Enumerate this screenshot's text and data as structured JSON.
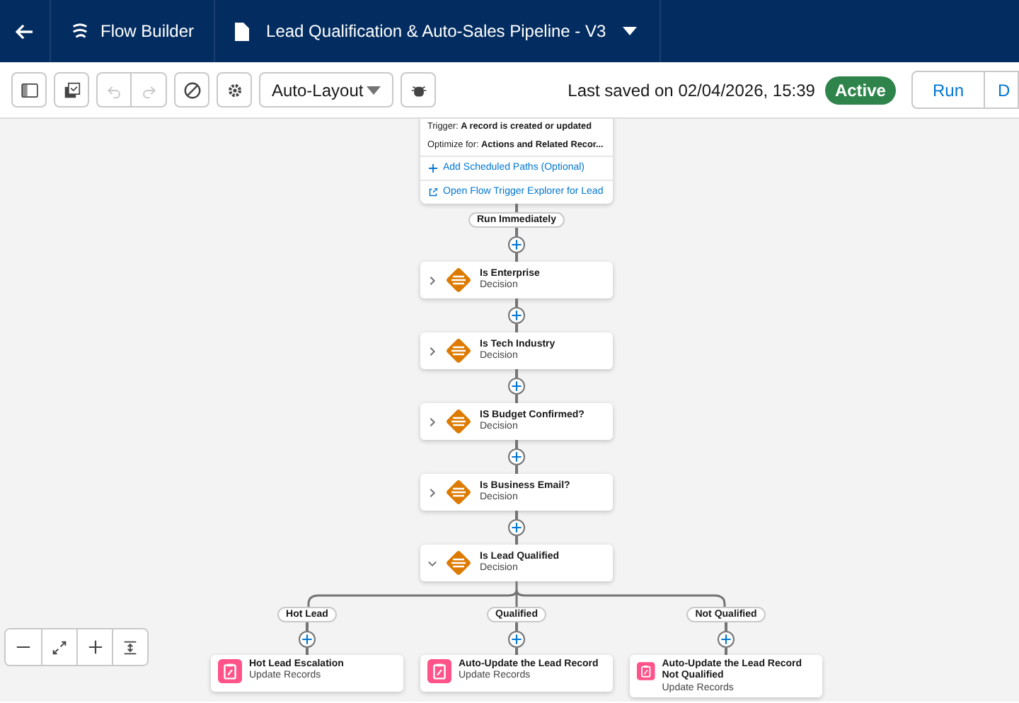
{
  "header": {
    "app_name": "Flow Builder",
    "flow_title": "Lead Qualification & Auto-Sales Pipeline - V3"
  },
  "toolbar": {
    "history_buttons": [
      {
        "kind": "undo",
        "disabled": true
      },
      {
        "kind": "redo",
        "disabled": true
      }
    ],
    "layout_select": "Auto-Layout",
    "last_saved": "Last saved on 02/04/2026, 15:39",
    "status": "Active",
    "buttons": [
      "Run",
      "D"
    ]
  },
  "start_node": {
    "trigger_label": "Trigger:",
    "trigger": "A record is created or updated",
    "optimize_label": "Optimize for:",
    "optimize": "Actions and Related Recor...",
    "links": [
      {
        "kind": "add",
        "label": "Add Scheduled Paths (Optional)"
      },
      {
        "kind": "open",
        "label": "Open Flow Trigger Explorer for Lead"
      }
    ]
  },
  "path_label": "Run Immediately",
  "decisions": [
    {
      "title": "Is Enterprise",
      "type": "Decision",
      "expanded": false
    },
    {
      "title": "Is Tech Industry",
      "type": "Decision",
      "expanded": false
    },
    {
      "title": "IS Budget Confirmed?",
      "type": "Decision",
      "expanded": false
    },
    {
      "title": "Is Business Email?",
      "type": "Decision",
      "expanded": false
    },
    {
      "title": "Is Lead Qualified",
      "type": "Decision",
      "expanded": true
    }
  ],
  "branches": [
    {
      "label": "Hot Lead",
      "node": {
        "title": "Hot Lead Escalation",
        "type": "Update Records"
      }
    },
    {
      "label": "Qualified",
      "node": {
        "title": "Auto-Update the Lead Record",
        "type": "Update Records"
      }
    },
    {
      "label": "Not Qualified",
      "node": {
        "title": "Auto-Update the Lead Record Not Qualified",
        "type": "Update Records"
      }
    }
  ]
}
